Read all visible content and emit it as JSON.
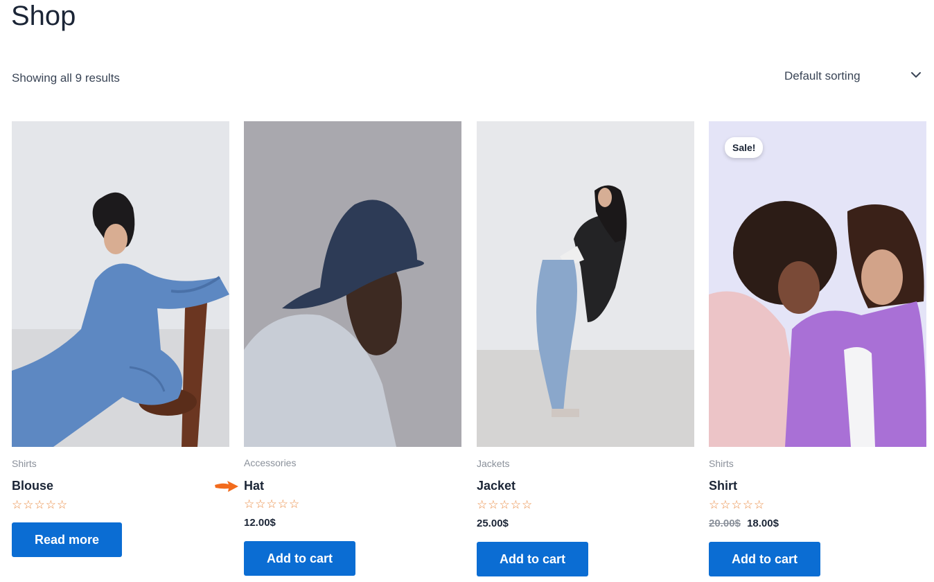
{
  "page": {
    "title": "Shop",
    "result_count": "Showing all 9 results",
    "sorting_label": "Default sorting"
  },
  "products": [
    {
      "category": "Shirts",
      "title": "Blouse",
      "rating_stars": 0,
      "price": "",
      "button_label": "Read more",
      "image": "woman-in-blue-dress-on-chair"
    },
    {
      "category": "Accessories",
      "title": "Hat",
      "rating_stars": 0,
      "price": "12.00$",
      "button_label": "Add to cart",
      "image": "man-in-bucket-hat"
    },
    {
      "category": "Jackets",
      "title": "Jacket",
      "rating_stars": 0,
      "price": "25.00$",
      "button_label": "Add to cart",
      "image": "woman-in-black-jacket-leaning-back"
    },
    {
      "category": "Shirts",
      "title": "Shirt",
      "rating_stars": 0,
      "price_old": "20.00$",
      "price": "18.00$",
      "badge": "Sale!",
      "button_label": "Add to cart",
      "image": "two-women-in-pastel-shirts"
    }
  ],
  "colors": {
    "accent": "#0b6dd3",
    "star": "#e9873c",
    "arrow": "#f26b1d"
  }
}
